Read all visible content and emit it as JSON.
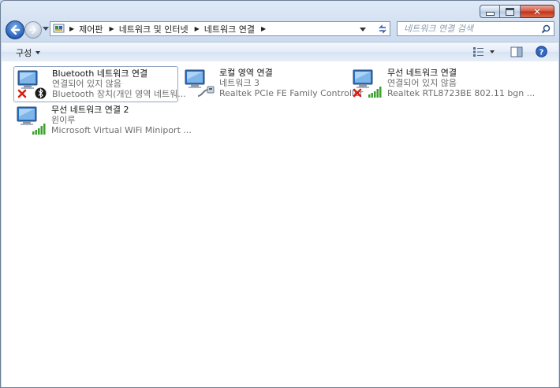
{
  "window": {
    "caption": {
      "minimize": "minimize",
      "maximize": "maximize",
      "close": "✕"
    }
  },
  "address": {
    "breadcrumbs": [
      "제어판",
      "네트워크 및 인터넷",
      "네트워크 연결"
    ]
  },
  "search": {
    "placeholder": "네트워크 연결 검색"
  },
  "toolbar": {
    "organize_label": "구성"
  },
  "connections": [
    {
      "name": "Bluetooth 네트워크 연결",
      "status": "연결되어 있지 않음",
      "device": "Bluetooth 장치(개인 영역 네트워...",
      "badge": "bluetooth",
      "disconnected": true,
      "selected": true
    },
    {
      "name": "로컬 영역 연결",
      "status": "네트워크  3",
      "device": "Realtek PCIe FE Family Controller",
      "badge": "ethernet-cable",
      "disconnected": false,
      "selected": false
    },
    {
      "name": "무선 네트워크 연결",
      "status": "연결되어 있지 않음",
      "device": "Realtek RTL8723BE 802.11 bgn ...",
      "badge": "wifi-signal",
      "disconnected": true,
      "selected": false
    },
    {
      "name": "무선 네트워크 연결 2",
      "status": "윈이루",
      "device": "Microsoft Virtual WiFi Miniport ...",
      "badge": "wifi-signal",
      "disconnected": false,
      "selected": false
    }
  ],
  "colors": {
    "accent": "#2a62b8",
    "error": "#d41f12",
    "signal": "#3aa12c"
  }
}
